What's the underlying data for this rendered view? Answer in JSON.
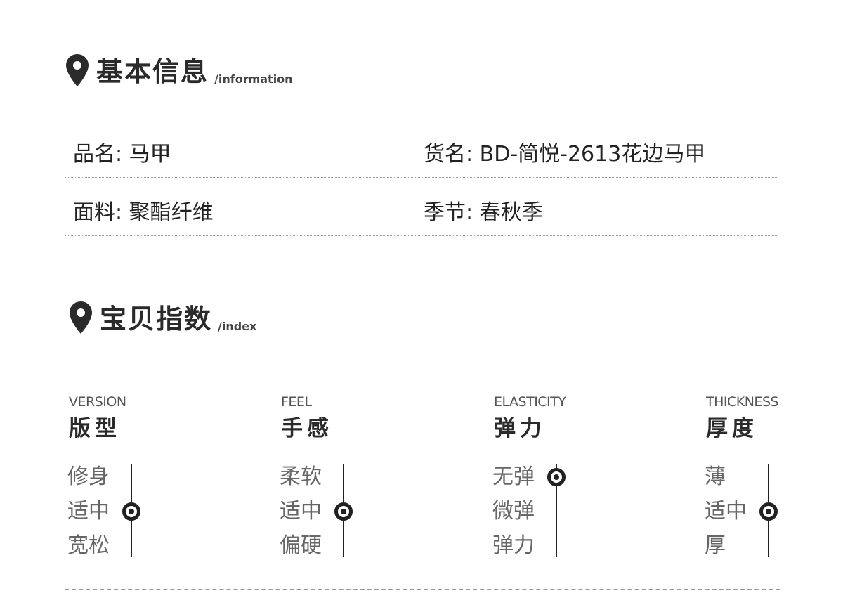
{
  "basic_info": {
    "title": "基本信息",
    "subtitle": "/information",
    "rows": [
      {
        "left": "品名: 马甲",
        "right": "货名: BD-简悦-2613花边马甲"
      },
      {
        "left": "面料: 聚酯纤维",
        "right": "季节: 春秋季"
      }
    ]
  },
  "index": {
    "title": "宝贝指数",
    "subtitle": "/index",
    "metrics": [
      {
        "en": "VERSION",
        "cn": "版型",
        "levels": [
          "修身",
          "适中",
          "宽松"
        ],
        "selected_index": 1
      },
      {
        "en": "FEEL",
        "cn": "手感",
        "levels": [
          "柔软",
          "适中",
          "偏硬"
        ],
        "selected_index": 1
      },
      {
        "en": "ELASTICITY",
        "cn": "弹力",
        "levels": [
          "无弹",
          "微弹",
          "弹力"
        ],
        "selected_index": 0
      },
      {
        "en": "THICKNESS",
        "cn": "厚度",
        "levels": [
          "薄",
          "适中",
          "厚"
        ],
        "selected_index": 1
      }
    ]
  },
  "icons": {
    "section": "location-pin-icon",
    "marker": "selected-level-marker-icon"
  },
  "colors": {
    "text": "#222222",
    "muted": "#666666",
    "rule": "#999999"
  }
}
